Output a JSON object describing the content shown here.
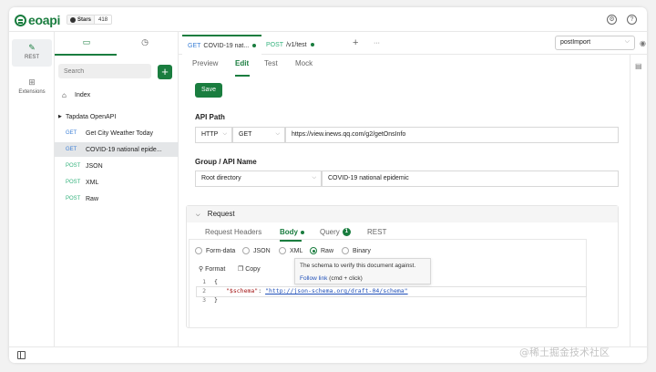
{
  "app": {
    "logo_text": "eoapi",
    "stars_label": "Stars",
    "stars_count": "418",
    "settings_icon": "gear-icon",
    "help_icon": "help-icon"
  },
  "rail": {
    "items": [
      {
        "label": "REST",
        "icon": "rest-icon",
        "active": true
      },
      {
        "label": "Extensions",
        "icon": "extensions-icon",
        "active": false
      }
    ]
  },
  "tree": {
    "tabs": [
      {
        "icon": "folder-icon",
        "active": true
      },
      {
        "icon": "history-icon",
        "active": false
      }
    ],
    "search_placeholder": "Search",
    "add_label": "+",
    "index_label": "Index",
    "group_label": "Tapdata OpenAPI",
    "items": [
      {
        "method": "GET",
        "name": "Get City Weather Today",
        "selected": false
      },
      {
        "method": "GET",
        "name": "COVID-19 national epide...",
        "selected": true
      },
      {
        "method": "POST",
        "name": "JSON",
        "selected": false
      },
      {
        "method": "POST",
        "name": "XML",
        "selected": false
      },
      {
        "method": "POST",
        "name": "Raw",
        "selected": false
      }
    ]
  },
  "tabs": [
    {
      "method": "GET",
      "name": "COVID-19 nat...",
      "active": true
    },
    {
      "method": "POST",
      "name": "/v1/test",
      "active": false
    }
  ],
  "tab_add_label": "+",
  "tab_more_label": "···",
  "env_select_value": "postImport",
  "subtabs": [
    {
      "label": "Preview",
      "active": false
    },
    {
      "label": "Edit",
      "active": true
    },
    {
      "label": "Test",
      "active": false
    },
    {
      "label": "Mock",
      "active": false
    }
  ],
  "save_label": "Save",
  "api_path": {
    "title": "API Path",
    "protocol": "HTTP",
    "method": "GET",
    "url": "https://view.inews.qq.com/g2/getOnsInfo"
  },
  "group_api": {
    "title": "Group / API Name",
    "group": "Root directory",
    "name": "COVID-19 national epidemic"
  },
  "request": {
    "title": "Request",
    "tabs": [
      {
        "label": "Request Headers",
        "active": false
      },
      {
        "label": "Body",
        "active": true
      },
      {
        "label": "Query",
        "active": false,
        "badge": "1"
      },
      {
        "label": "REST",
        "active": false
      }
    ],
    "body_types": [
      {
        "label": "Form-data",
        "checked": false
      },
      {
        "label": "JSON",
        "checked": false
      },
      {
        "label": "XML",
        "checked": false
      },
      {
        "label": "Raw",
        "checked": true
      },
      {
        "label": "Binary",
        "checked": false
      }
    ],
    "tools": {
      "format": "Format",
      "copy": "Copy"
    },
    "code": {
      "lines": [
        {
          "no": "1",
          "text": "{"
        },
        {
          "no": "2",
          "key": "\"$schema\"",
          "colon": ": ",
          "value": "\"http://json-schema.org/draft-04/schema\""
        },
        {
          "no": "3",
          "text": "}"
        }
      ]
    },
    "tooltip": {
      "text": "The schema to verify this document against.",
      "link": "Follow link",
      "hint": " (cmd + click)"
    }
  },
  "watermark": "@稀土掘金技术社区"
}
